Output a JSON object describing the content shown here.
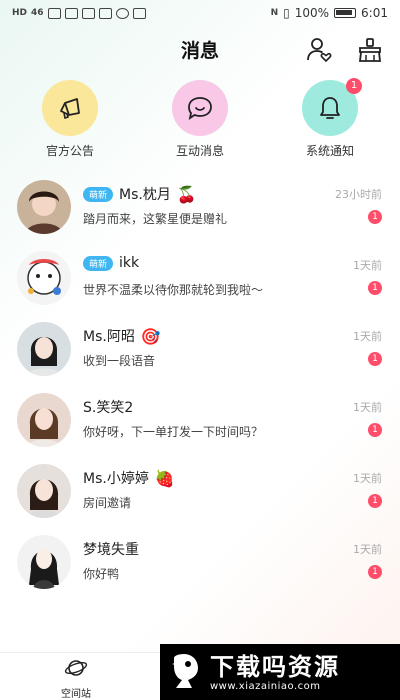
{
  "status_bar": {
    "left_labels": [
      "HD",
      "46"
    ],
    "nfc": "N",
    "battery": "100%",
    "time": "6:01"
  },
  "header": {
    "title": "消息",
    "friends_icon": "person-heart-icon",
    "clean_icon": "broom-icon"
  },
  "categories": [
    {
      "label": "官方公告",
      "icon": "megaphone-icon",
      "color": "#fbe79a"
    },
    {
      "label": "互动消息",
      "icon": "chat-bubble-icon",
      "color": "#f8c8e6"
    },
    {
      "label": "系统通知",
      "icon": "bell-icon",
      "color": "#9eeadf",
      "badge": "1"
    }
  ],
  "messages": [
    {
      "name": "Ms.枕月",
      "emoji": "🍒",
      "tag": "萌新",
      "time": "23小时前",
      "preview": "踏月而来，这繁星便是赠礼",
      "unread": "1"
    },
    {
      "name": "ikk",
      "emoji": "",
      "tag": "萌新",
      "time": "1天前",
      "preview": "世界不温柔以待你那就轮到我啦～",
      "unread": "1"
    },
    {
      "name": "Ms.阿昭",
      "emoji": "🎯",
      "tag": "",
      "time": "1天前",
      "preview": "收到一段语音",
      "unread": "1"
    },
    {
      "name": "S.笑笑2",
      "emoji": "",
      "tag": "",
      "time": "1天前",
      "preview": "你好呀，下一单打发一下时间吗？",
      "unread": "1"
    },
    {
      "name": "Ms.小婷婷",
      "emoji": "🍓",
      "tag": "",
      "time": "1天前",
      "preview": "房间邀请",
      "unread": "1"
    },
    {
      "name": "梦境失重",
      "emoji": "",
      "tag": "",
      "time": "1天前",
      "preview": "你好鸭",
      "unread": "1"
    }
  ],
  "tabbar": {
    "station_label": "空间站"
  },
  "watermark": {
    "title": "下载吗资源",
    "url": "www.xiazainiao.com"
  },
  "colors": {
    "badge": "#ff4d6a",
    "new_tag": "#3fb6f2"
  }
}
